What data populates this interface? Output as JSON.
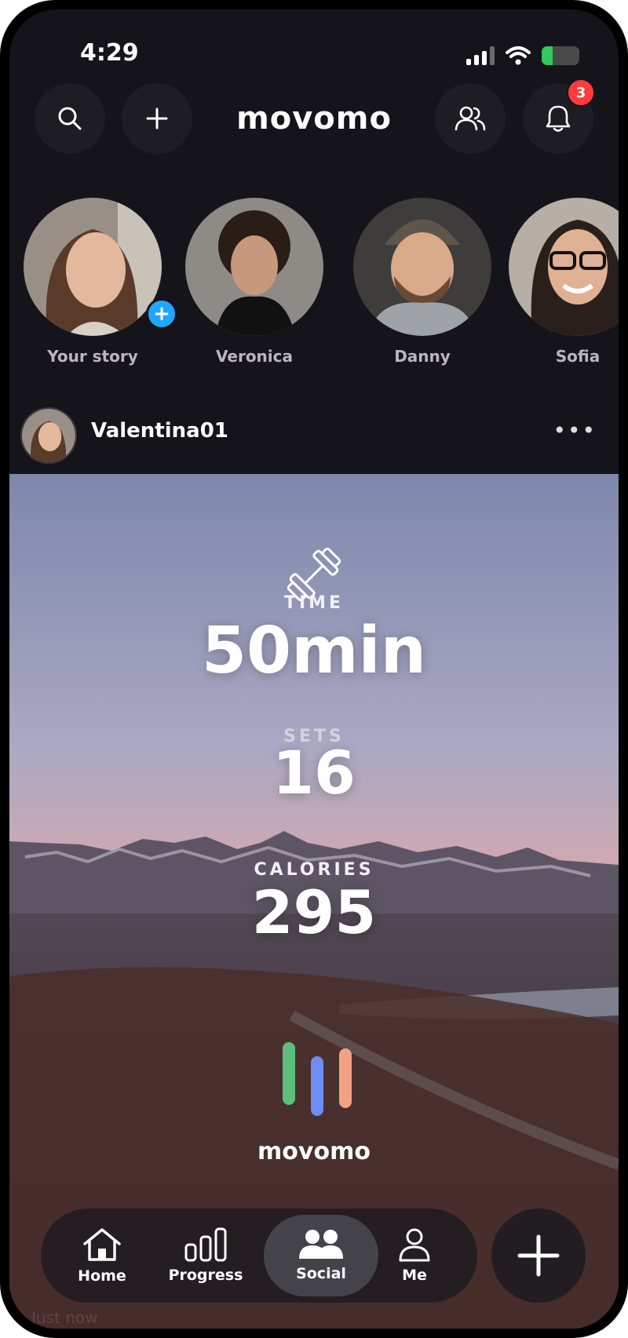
{
  "status_bar": {
    "time": "4:29",
    "battery_fraction": 0.3
  },
  "header": {
    "brand": "movomo",
    "notification_count": "3",
    "icons": [
      "search-icon",
      "plus-icon",
      "friends-icon",
      "bell-icon"
    ]
  },
  "stories": [
    {
      "name": "Your story",
      "is_own": true
    },
    {
      "name": "Veronica"
    },
    {
      "name": "Danny"
    },
    {
      "name": "Sofia"
    }
  ],
  "post": {
    "username": "Valentina01",
    "more_icon": "more-dots-icon",
    "workout_icon": "dumbbell-icon",
    "stats": [
      {
        "label": "TIME",
        "value": "50min"
      },
      {
        "label": "SETS",
        "value": "16"
      },
      {
        "label": "CALORIES",
        "value": "295"
      }
    ],
    "watermark": "movomo",
    "bar_colors": [
      "#5dbf7d",
      "#6f8cf2",
      "#f0a083"
    ],
    "timestamp": "Just now"
  },
  "nav": {
    "items": [
      {
        "label": "Home",
        "icon": "home-icon"
      },
      {
        "label": "Progress",
        "icon": "progress-icon"
      },
      {
        "label": "Social",
        "icon": "social-icon",
        "active": true
      },
      {
        "label": "Me",
        "icon": "profile-icon"
      }
    ],
    "fab_icon": "plus-icon"
  }
}
